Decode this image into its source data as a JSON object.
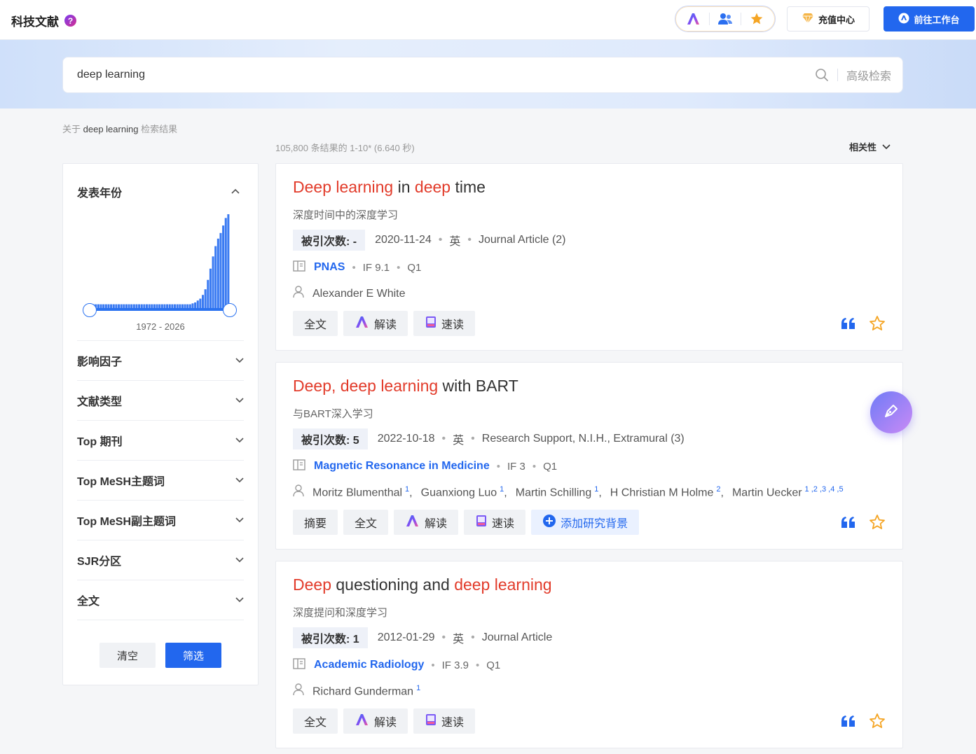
{
  "header": {
    "brand_title": "科技文献",
    "help_icon": "?",
    "recharge_label": "充值中心",
    "workbench_label": "前往工作台"
  },
  "search": {
    "query": "deep learning",
    "advanced_label": "高级检索"
  },
  "results": {
    "about_prefix": "关于",
    "about_keyword": "deep learning",
    "about_suffix": "检索结果",
    "count_text": "105,800 条结果的 1-10* (6.640 秒)",
    "sort_label": "相关性"
  },
  "sidebar": {
    "year_filter": {
      "title": "发表年份",
      "range": "1972 - 2026",
      "histogram": [
        0.04,
        0.04,
        0.04,
        0.04,
        0.04,
        0.04,
        0.04,
        0.04,
        0.04,
        0.04,
        0.04,
        0.04,
        0.04,
        0.04,
        0.04,
        0.04,
        0.04,
        0.04,
        0.04,
        0.04,
        0.04,
        0.04,
        0.04,
        0.04,
        0.04,
        0.04,
        0.04,
        0.04,
        0.04,
        0.04,
        0.04,
        0.04,
        0.04,
        0.04,
        0.04,
        0.04,
        0.04,
        0.04,
        0.04,
        0.04,
        0.05,
        0.06,
        0.08,
        0.1,
        0.14,
        0.2,
        0.3,
        0.42,
        0.55,
        0.66,
        0.74,
        0.8,
        0.88,
        0.96,
        1.0
      ]
    },
    "filters": [
      {
        "label": "影响因子"
      },
      {
        "label": "文献类型"
      },
      {
        "label": "Top 期刊"
      },
      {
        "label": "Top MeSH主题词"
      },
      {
        "label": "Top MeSH副主题词"
      },
      {
        "label": "SJR分区"
      },
      {
        "label": "全文"
      }
    ],
    "clear_label": "清空",
    "filter_label": "筛选"
  },
  "cards": [
    {
      "title": [
        {
          "t": "Deep learning",
          "hl": true
        },
        {
          "t": " in ",
          "hl": false
        },
        {
          "t": "deep",
          "hl": true
        },
        {
          "t": " time",
          "hl": false
        }
      ],
      "subtitle": "深度时间中的深度学习",
      "cite": "被引次数: -",
      "date": "2020-11-24",
      "lang": "英",
      "type": "Journal Article (2)",
      "journal": "PNAS",
      "if": "IF 9.1",
      "quartile": "Q1",
      "authors": [
        {
          "name": "Alexander E White",
          "sup": ""
        }
      ],
      "actions": [
        {
          "label": "全文",
          "icon": ""
        },
        {
          "label": "解读",
          "icon": "ai-logo-icon"
        },
        {
          "label": "速读",
          "icon": "book-icon"
        }
      ]
    },
    {
      "title": [
        {
          "t": "Deep, deep learning",
          "hl": true
        },
        {
          "t": " with BART",
          "hl": false
        }
      ],
      "subtitle": "与BART深入学习",
      "cite": "被引次数: 5",
      "date": "2022-10-18",
      "lang": "英",
      "type": "Research Support, N.I.H., Extramural (3)",
      "journal": "Magnetic Resonance in Medicine",
      "if": "IF 3",
      "quartile": "Q1",
      "authors": [
        {
          "name": "Moritz Blumenthal",
          "sup": "1"
        },
        {
          "name": "Guanxiong Luo",
          "sup": "1"
        },
        {
          "name": "Martin Schilling",
          "sup": "1"
        },
        {
          "name": "H Christian M Holme",
          "sup": "2"
        },
        {
          "name": "Martin Uecker",
          "sup": "1 ,2 ,3 ,4 ,5"
        }
      ],
      "actions": [
        {
          "label": "摘要",
          "icon": ""
        },
        {
          "label": "全文",
          "icon": ""
        },
        {
          "label": "解读",
          "icon": "ai-logo-icon"
        },
        {
          "label": "速读",
          "icon": "book-icon"
        },
        {
          "label": "添加研究背景",
          "icon": "plus-circle-icon"
        }
      ]
    },
    {
      "title": [
        {
          "t": "Deep",
          "hl": true
        },
        {
          "t": " questioning and ",
          "hl": false
        },
        {
          "t": "deep learning",
          "hl": true
        }
      ],
      "subtitle": "深度提问和深度学习",
      "cite": "被引次数: 1",
      "date": "2012-01-29",
      "lang": "英",
      "type": "Journal Article",
      "journal": "Academic Radiology",
      "if": "IF 3.9",
      "quartile": "Q1",
      "authors": [
        {
          "name": "Richard Gunderman",
          "sup": "1"
        }
      ],
      "actions": [
        {
          "label": "全文",
          "icon": ""
        },
        {
          "label": "解读",
          "icon": "ai-logo-icon"
        },
        {
          "label": "速读",
          "icon": "book-icon"
        }
      ]
    }
  ],
  "colors": {
    "accent": "#2267ee",
    "highlight": "#e23b2a",
    "star": "#f5a524"
  }
}
